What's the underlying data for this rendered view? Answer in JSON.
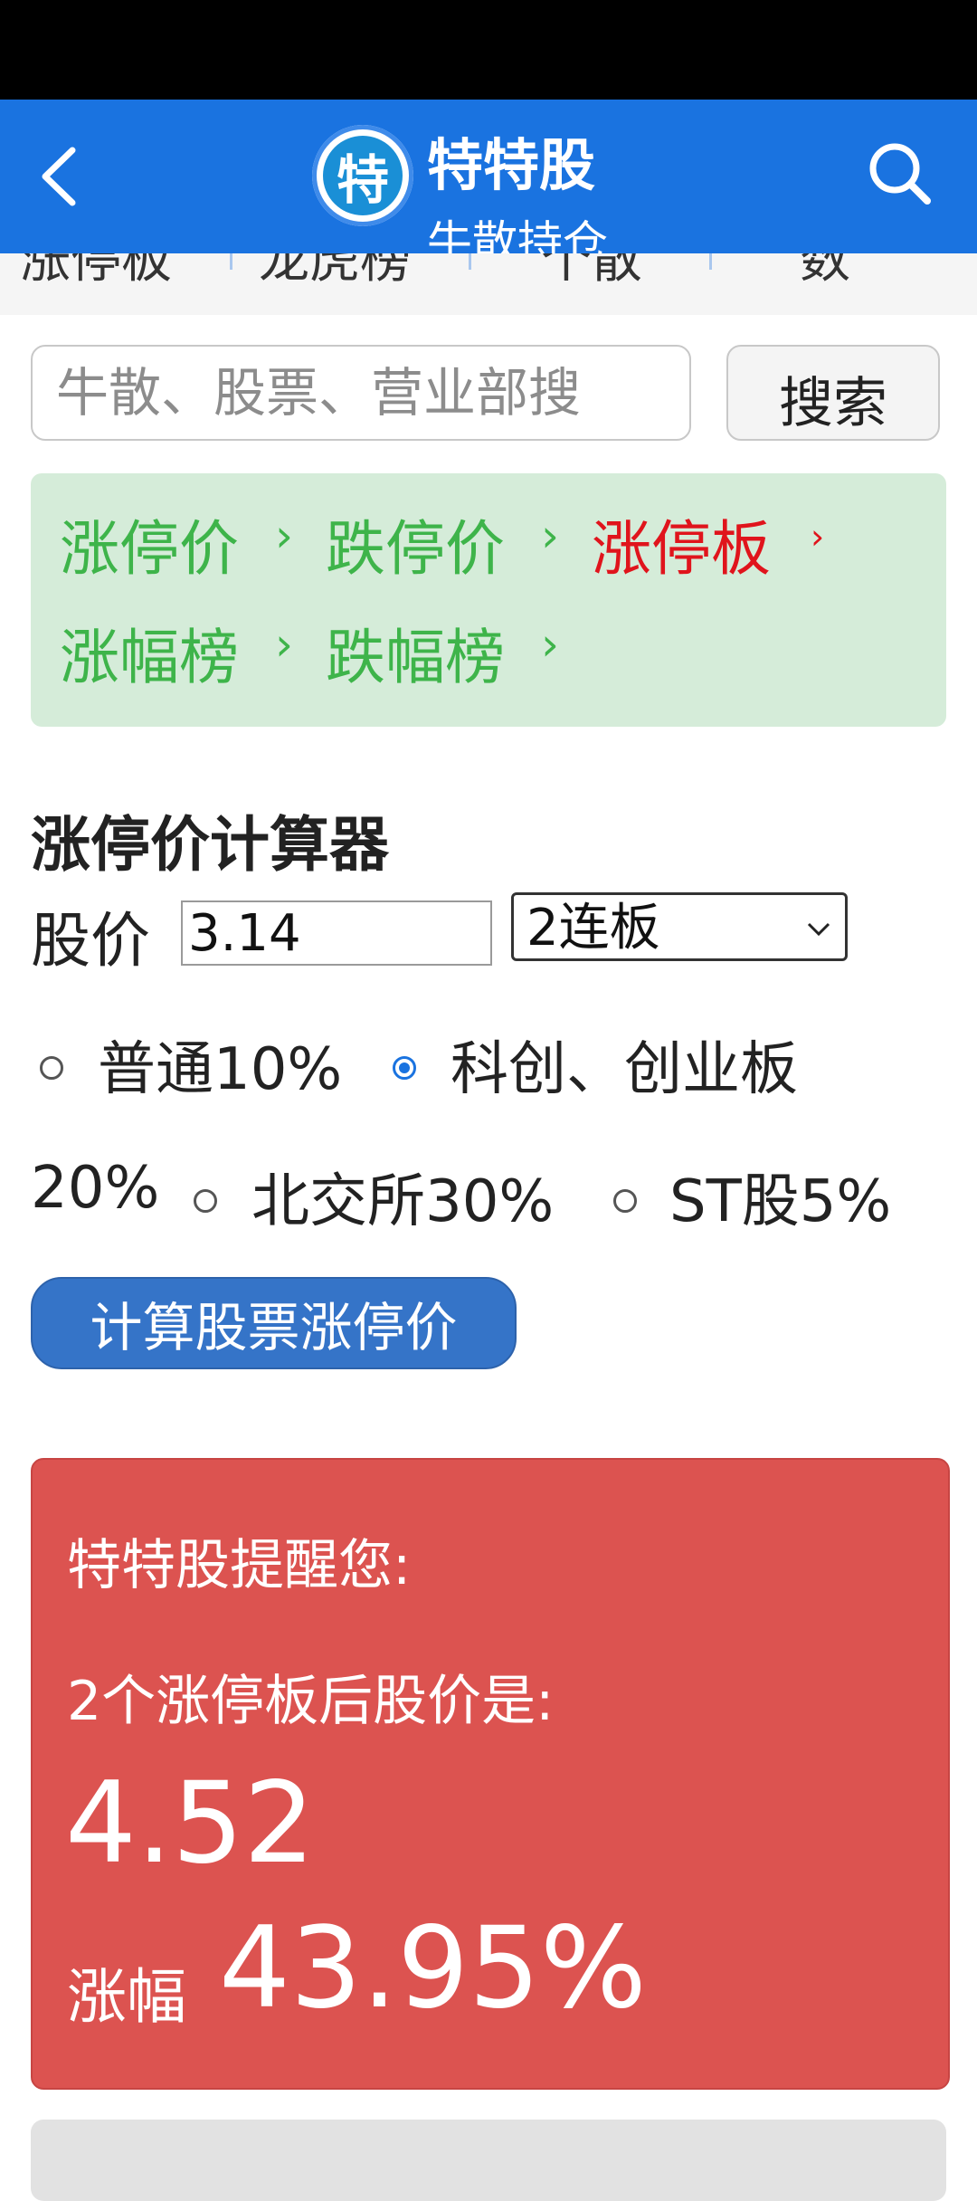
{
  "header": {
    "logo_char": "特",
    "title": "特特股",
    "subtitle": "牛散持仓"
  },
  "tabs": [
    "涨停板",
    "龙虎榜",
    "个散",
    "数"
  ],
  "search": {
    "placeholder": "牛散、股票、营业部搜",
    "button_label": "搜索"
  },
  "nav_links": [
    {
      "label": "涨停价",
      "active": false
    },
    {
      "label": "跌停价",
      "active": false
    },
    {
      "label": "涨停板",
      "active": true
    },
    {
      "label": "涨幅榜",
      "active": false
    },
    {
      "label": "跌幅榜",
      "active": false
    }
  ],
  "calculator": {
    "title": "涨停价计算器",
    "price_label": "股价",
    "price_value": "3.14",
    "board_selected": "2连板",
    "options": [
      {
        "label": "普通10%",
        "checked": false
      },
      {
        "label": "科创、创业板",
        "checked": true
      },
      {
        "label": "20%",
        "checked": false
      },
      {
        "label": "北交所30%",
        "checked": false
      },
      {
        "label": "ST股5%",
        "checked": false
      }
    ],
    "button_label": "计算股票涨停价"
  },
  "result": {
    "line1": "特特股提醒您:",
    "line2": "2个涨停板后股价是:",
    "price": "4.52",
    "gain_label": "涨幅",
    "gain_value": "43.95%"
  },
  "colors": {
    "header_bg": "#1a73e0",
    "nav_green": "#3eb44a",
    "nav_red": "#e0141c",
    "result_bg": "#dc5350",
    "button_bg": "#3574c8"
  }
}
